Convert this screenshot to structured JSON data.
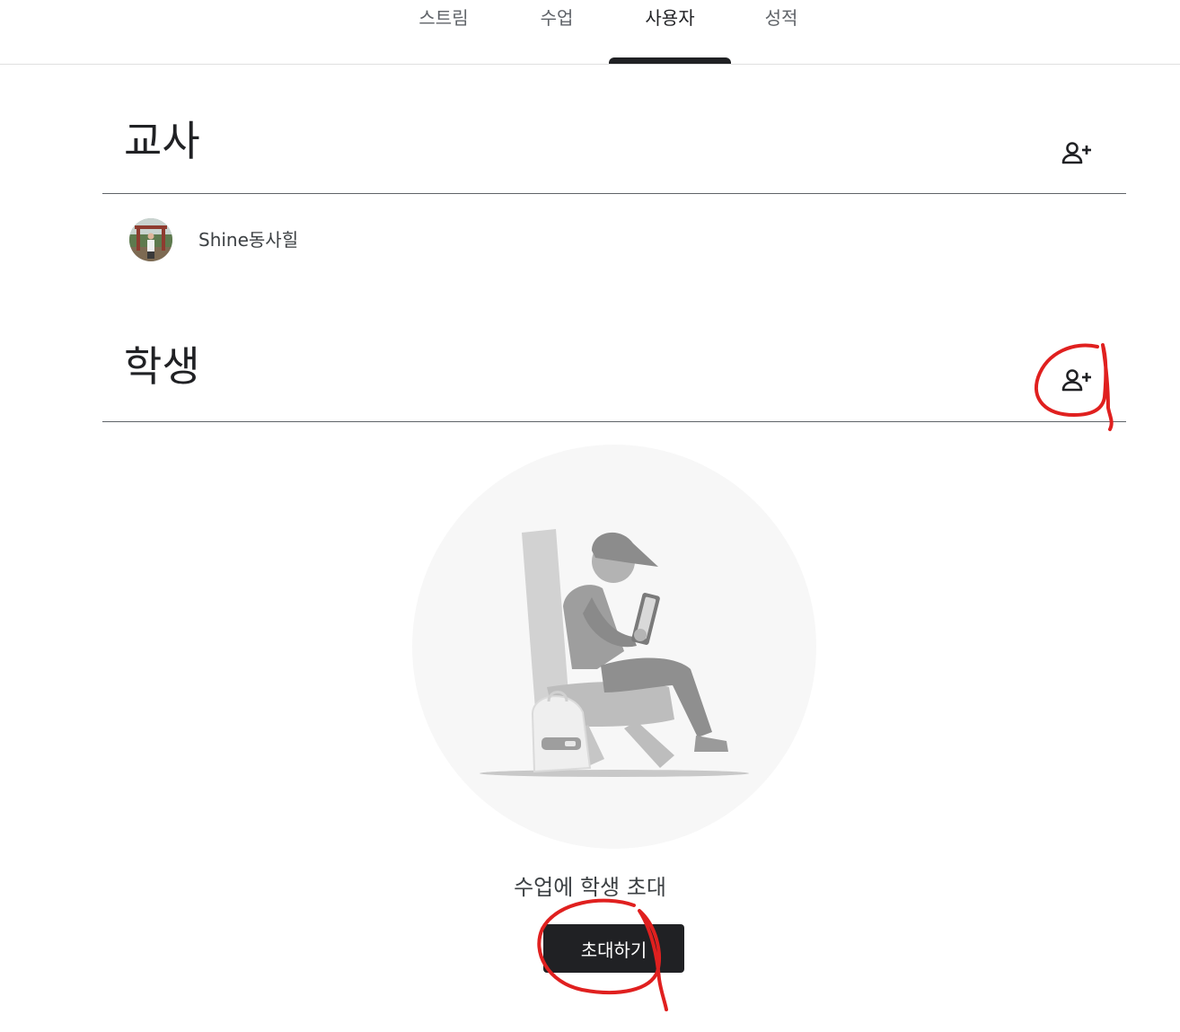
{
  "nav": {
    "tabs": [
      {
        "label": "스트림"
      },
      {
        "label": "수업"
      },
      {
        "label": "사용자",
        "active": true
      },
      {
        "label": "성적"
      }
    ]
  },
  "teachers": {
    "title": "교사",
    "add_icon": "person-add-icon",
    "list": [
      {
        "name": "Shine동사힐"
      }
    ]
  },
  "students": {
    "title": "학생",
    "add_icon": "person-add-icon",
    "empty_state": {
      "illustration": "student-on-chair-with-phone",
      "message": "수업에 학생 초대",
      "button_label": "초대하기"
    }
  },
  "colors": {
    "text_primary": "#202124",
    "text_secondary": "#5f6368",
    "button_bg": "#202124",
    "annotation": "#e0201f"
  }
}
